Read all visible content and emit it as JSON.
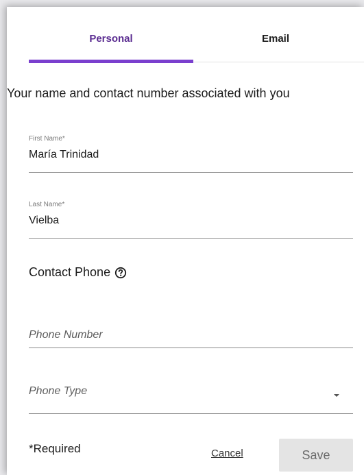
{
  "tabs": {
    "personal": "Personal",
    "email": "Email"
  },
  "intro_text": "Your name and contact number associated with you",
  "first_name": {
    "label": "First Name*",
    "value": "María Trinidad"
  },
  "last_name": {
    "label": "Last Name*",
    "value": "Vielba"
  },
  "contact_phone": {
    "title": "Contact Phone",
    "help_icon": "question-circle-icon",
    "phone_number_placeholder": "Phone Number",
    "phone_type_placeholder": "Phone Type",
    "dropdown_icon": "caret-down-icon"
  },
  "footer": {
    "required_note": "*Required",
    "cancel_label": "Cancel",
    "save_label": "Save"
  },
  "colors": {
    "accent": "#7a3fce",
    "active_tab_text": "#5b2d91",
    "save_button_bg": "#e4e4e4"
  }
}
